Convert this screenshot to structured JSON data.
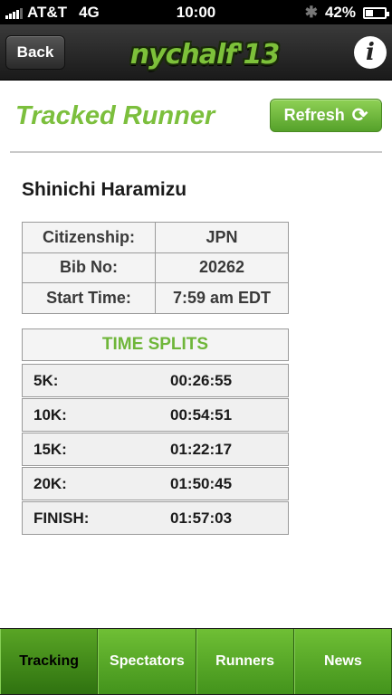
{
  "status_bar": {
    "carrier": "AT&T",
    "network": "4G",
    "time": "10:00",
    "battery_percent": "42%",
    "battery_level": 0.42,
    "signal_bars": 4
  },
  "nav": {
    "back_label": "Back",
    "logo_text": "nychalf'13",
    "info_icon": "info-icon"
  },
  "page": {
    "title": "Tracked Runner",
    "refresh_label": "Refresh"
  },
  "runner": {
    "name": "Shinichi Haramizu",
    "info": [
      {
        "label": "Citizenship:",
        "value": "JPN"
      },
      {
        "label": "Bib No:",
        "value": "20262"
      },
      {
        "label": "Start Time:",
        "value": "7:59 am EDT"
      }
    ]
  },
  "splits": {
    "header": "TIME SPLITS",
    "rows": [
      {
        "label": "5K:",
        "time": "00:26:55"
      },
      {
        "label": "10K:",
        "time": "00:54:51"
      },
      {
        "label": "15K:",
        "time": "01:22:17"
      },
      {
        "label": "20K:",
        "time": "01:50:45"
      },
      {
        "label": "FINISH:",
        "time": "01:57:03"
      }
    ]
  },
  "tabs": [
    {
      "label": "Tracking",
      "active": true
    },
    {
      "label": "Spectators",
      "active": false
    },
    {
      "label": "Runners",
      "active": false
    },
    {
      "label": "News",
      "active": false
    }
  ],
  "colors": {
    "accent_green": "#7cbf3d",
    "navbar": "#2a2a2a"
  }
}
